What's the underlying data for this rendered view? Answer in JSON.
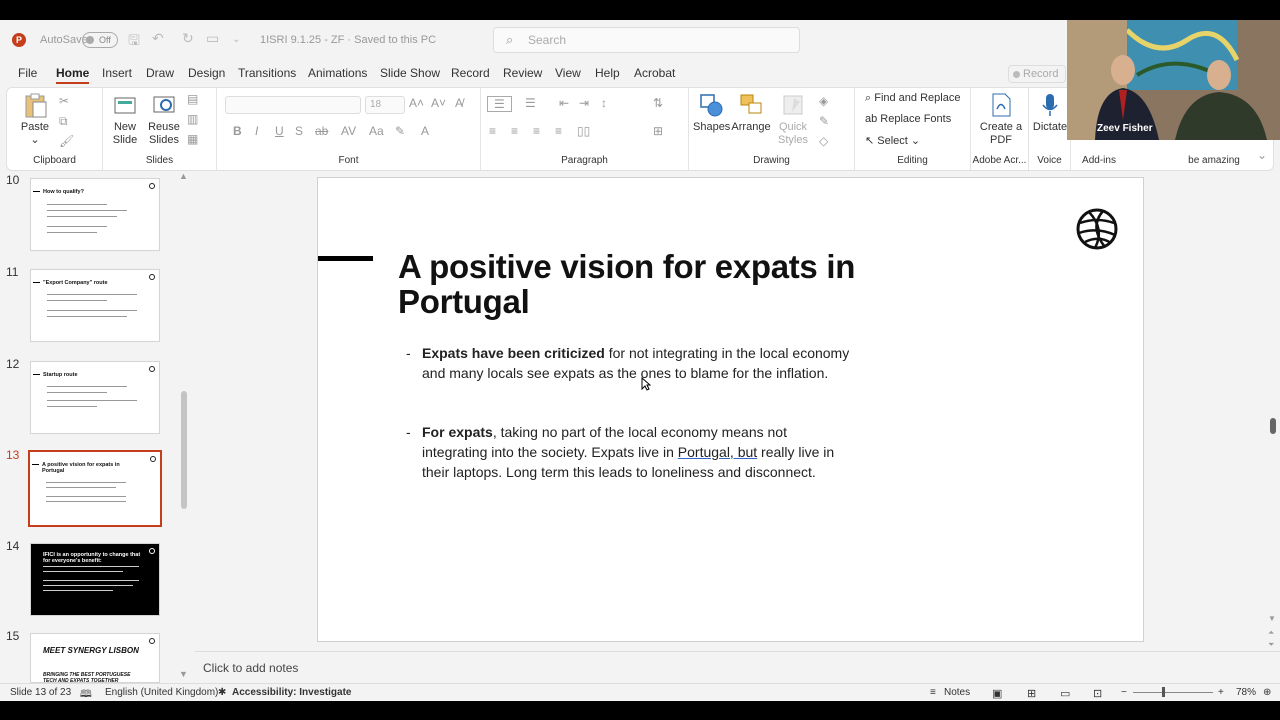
{
  "app": {
    "logo_letter": "P",
    "autosave": "AutoSave",
    "toggle": "Off",
    "doc_title": "1ISRI 9.1.25 - ZF  ·  Saved to this PC",
    "search_placeholder": "Search"
  },
  "tabs": [
    "File",
    "Home",
    "Insert",
    "Draw",
    "Design",
    "Transitions",
    "Animations",
    "Slide Show",
    "Record",
    "Review",
    "View",
    "Help",
    "Acrobat"
  ],
  "record_button": "Record",
  "ribbon": {
    "clipboard": {
      "paste": "Paste",
      "label": "Clipboard"
    },
    "slides": {
      "new_slide": "New Slide",
      "reuse_slides": "Reuse Slides",
      "label": "Slides"
    },
    "font": {
      "size": "18",
      "label": "Font"
    },
    "paragraph": {
      "label": "Paragraph"
    },
    "drawing": {
      "shapes": "Shapes",
      "arrange": "Arrange",
      "quick_styles": "Quick Styles",
      "label": "Drawing"
    },
    "editing": {
      "find_replace": "Find and Replace",
      "replace_fonts": "Replace Fonts",
      "select": "Select",
      "label": "Editing"
    },
    "adobe": {
      "create_pdf": "Create a PDF",
      "label": "Adobe Acr..."
    },
    "voice": {
      "dictate": "Dictate",
      "label": "Voice"
    },
    "addins": {
      "label": "Add-ins"
    },
    "extra": {
      "label": "be amazing"
    }
  },
  "video": {
    "name": "Zeev Fisher"
  },
  "thumbnails": [
    {
      "num": "10",
      "title": "How to qualify?"
    },
    {
      "num": "11",
      "title": "\"Export Company\" route"
    },
    {
      "num": "12",
      "title": "Startup route"
    },
    {
      "num": "13",
      "title": "A positive vision for expats in Portugal"
    },
    {
      "num": "14",
      "title": "IFICI is an opportunity to change that for everyone's benefit:"
    },
    {
      "num": "15",
      "title": "MEET SYNERGY LISBON",
      "subtitle": "BRINGING THE BEST PORTUGUESE TECH AND EXPATS TOGETHER"
    }
  ],
  "slide": {
    "title": "A positive vision for expats in Portugal",
    "bullets": [
      {
        "dash": "-",
        "bold": "Expats have been criticized",
        "rest": " for not integrating in the local economy and many locals see expats as the ones to blame for the inflation."
      },
      {
        "dash": "-",
        "bold": "For expats",
        "rest1": ", taking no part of the local economy means not integrating into the society. Expats live in ",
        "link": "Portugal, but",
        "rest2": " really live in their laptops. Long term this leads to loneliness and disconnect."
      }
    ]
  },
  "notes_placeholder": "Click to add notes",
  "status": {
    "slide": "Slide 13 of 23",
    "language": "English (United Kingdom)",
    "accessibility": "Accessibility: Investigate",
    "notes": "Notes",
    "zoom": "78%"
  }
}
